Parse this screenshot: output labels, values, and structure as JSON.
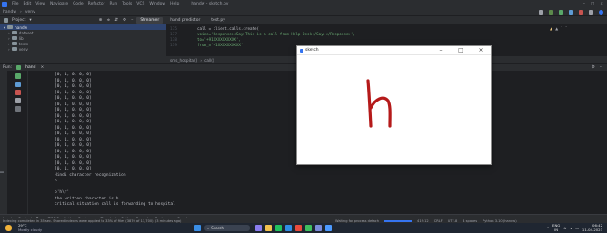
{
  "menubar": {
    "items": [
      "File",
      "Edit",
      "View",
      "Navigate",
      "Code",
      "Refactor",
      "Run",
      "Tools",
      "VCS",
      "Window",
      "Help"
    ],
    "project_title": "handw - sketch.py"
  },
  "pathbar": {
    "items": [
      "handw",
      "venv"
    ]
  },
  "toolbar": {
    "project_label": "Project",
    "tabs": [
      "Streamer",
      "hand predictor",
      "test.py"
    ]
  },
  "project_tree": {
    "items": [
      {
        "label": "handw",
        "selected": true
      },
      {
        "label": "dataset",
        "selected": false
      },
      {
        "label": "lib",
        "selected": false
      },
      {
        "label": "tests",
        "selected": false
      },
      {
        "label": "venv",
        "selected": false
      }
    ]
  },
  "editor": {
    "line_numbers": [
      "135",
      "137",
      "138",
      "139"
    ],
    "lines": [
      "call = client.calls.create(",
      "    voice='Response><Say>This is a call from Help Desk</Say></Response>',",
      "    to='+91XXXXXXXXXX',",
      "    from_='+1XXXXXXXXXX')"
    ],
    "breadcrumb": [
      "sms_hospital()",
      "call()"
    ]
  },
  "run": {
    "label": "Run:",
    "config": "hand"
  },
  "console": {
    "lines": [
      "[0, 1, 0, 0, 0]",
      "[0, 1, 0, 0, 0]",
      "[0, 1, 0, 0, 0]",
      "[0, 1, 0, 0, 0]",
      "[0, 1, 0, 0, 0]",
      "[0, 1, 0, 0, 0]",
      "[0, 1, 0, 0, 0]",
      "[0, 1, 0, 0, 0]",
      "[0, 1, 0, 0, 0]",
      "[0, 1, 0, 0, 0]",
      "[0, 1, 0, 0, 0]",
      "[0, 1, 0, 0, 0]",
      "[0, 1, 0, 0, 0]",
      "[0, 1, 0, 0, 0]",
      "[0, 1, 0, 0, 0]",
      "[0, 1, 0, 0, 0]",
      "[0, 1, 0, 0, 0]",
      "Hindi character recognization",
      "h",
      "",
      "b'h\\r'",
      "the written character is h",
      "critical situation call is forwarding to hospital"
    ]
  },
  "popup": {
    "title": "sketch",
    "controls": [
      "–",
      "□",
      "×"
    ],
    "drawn_letter": "h"
  },
  "tool_tabs": [
    "Version Control",
    "Run",
    "TODO",
    "Python Packages",
    "Terminal",
    "Python Console",
    "Problems",
    "Services"
  ],
  "statusbar": {
    "message": "Indexing completed in 35 sec. Shared indexes were applied to 33% of files (3870 of 11,700). (3 minutes ago)",
    "waiting": "Waiting for process detach",
    "position": "419:12",
    "line_sep": "CRLF",
    "encoding": "UTF-8",
    "indent": "4 spaces",
    "interpreter": "Python 3.10 (handw)"
  },
  "taskbar": {
    "weather": "29°C",
    "weather_sub": "Mostly cloudy",
    "search": "Search",
    "lang": "ENG",
    "lang_sub": "IN",
    "time": "06:42",
    "date": "11-04-2023"
  },
  "colors": {
    "accent": "#3574f0",
    "stroke": "#b51a1a"
  }
}
